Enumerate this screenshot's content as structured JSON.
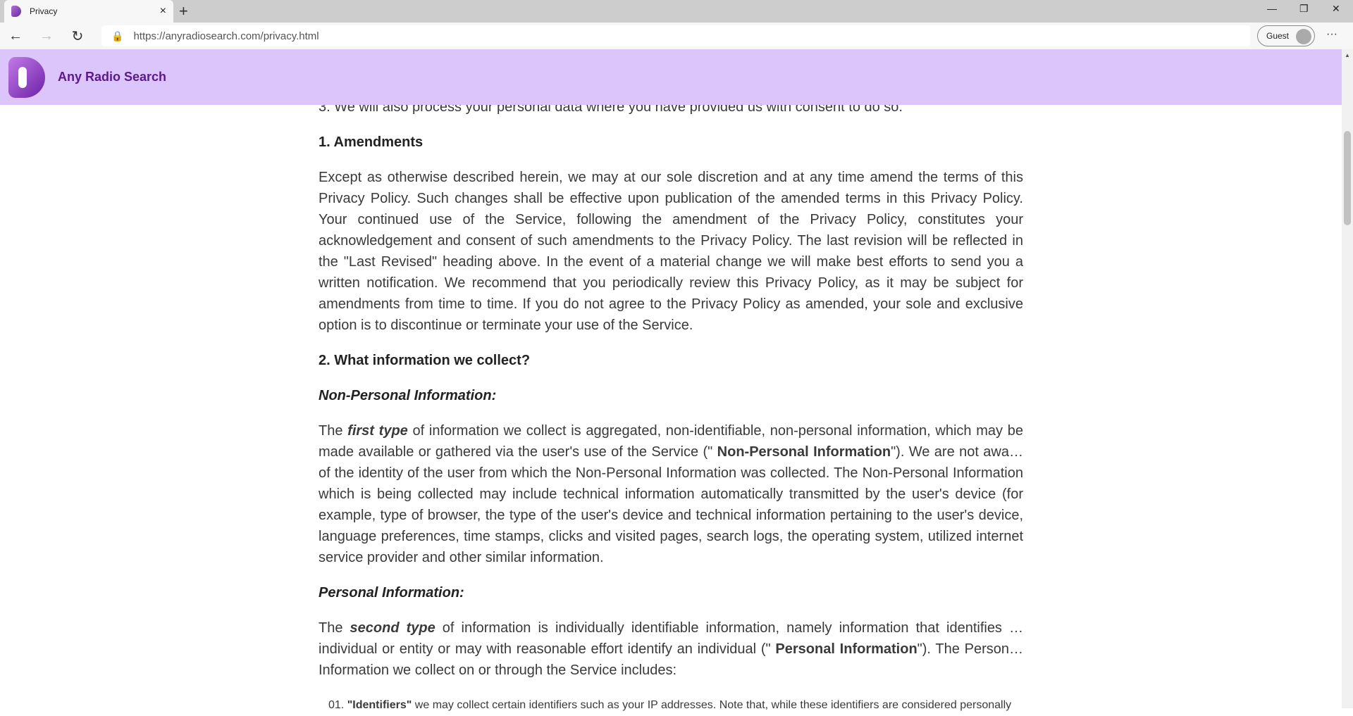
{
  "browser": {
    "tab_title": "Privacy",
    "url": "https://anyradiosearch.com/privacy.html",
    "profile": "Guest"
  },
  "site": {
    "brand": "Any Radio Search"
  },
  "content": {
    "intro_tail": "3. We will also process your personal data where you have provided us with consent to do so.",
    "h1": "1. Amendments",
    "p1": "Except as otherwise described herein, we may at our sole discretion and at any time amend the terms of this Privacy Policy. Such changes shall be effective upon publication of the amended terms in this Privacy Policy. Your continued use of the Service, following the amendment of the Privacy Policy, constitutes your acknowledgement and consent of such amendments to the Privacy Policy. The last revision will be reflected in the \"Last Revised\" heading above. In the event of a material change we will make best efforts to send you a written notification. We recommend that you periodically review this Privacy Policy, as it may be subject for amendments from time to time. If you do not agree to the Privacy Policy as amended, your sole and exclusive option is to discontinue or terminate your use of the Service.",
    "h2": "2. What information we collect?",
    "sub1": "Non-Personal Information:",
    "p2": {
      "a": "The ",
      "b": "first type",
      "c": " of information we collect is aggregated, non-identifiable, non-personal information, which may be made available or gathered via the user's use of the Service (\" ",
      "d": "Non-Personal Information",
      "e": "\"). We are not awa… of the identity of the user from which the Non-Personal Information was collected. The Non-Personal Information which is being collected may include technical information automatically transmitted by the user's device (for example, type of browser, the type of the user's device and technical information pertaining to the user's device, language preferences, time stamps, clicks and visited pages, search logs, the operating system, utilized internet service provider and other similar information."
    },
    "sub2": "Personal Information:",
    "p3": {
      "a": "The ",
      "b": "second type",
      "c": " of information is individually identifiable information, namely information that identifies … individual or entity or may with reasonable effort identify an individual (\" ",
      "d": "Personal Information",
      "e": "\"). The Person… Information we collect on or through the Service includes:"
    },
    "list": [
      {
        "num": "01.",
        "term": "\"Identifiers\"",
        "text": " we may collect certain identifiers such as your IP addresses. Note that, while these identifiers are considered personally"
      }
    ]
  }
}
